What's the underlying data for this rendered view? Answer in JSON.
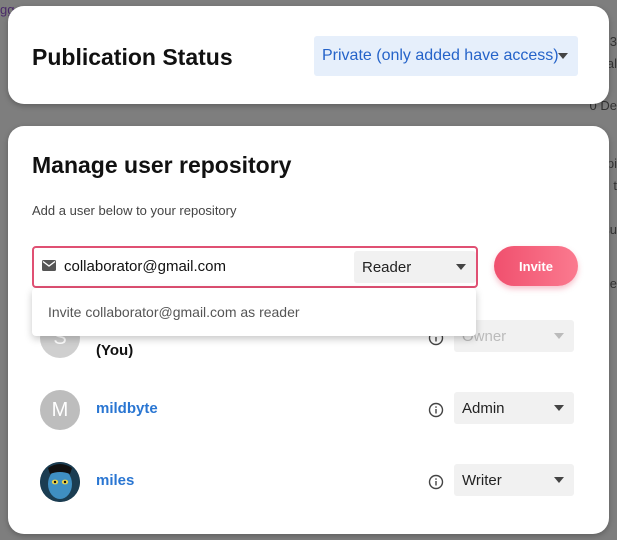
{
  "background": {
    "top_left_text": "gg...",
    "right_fragments": [
      "3",
      "al",
      "0 De",
      "pi",
      "t",
      "su",
      "e"
    ]
  },
  "publication": {
    "title": "Publication Status",
    "status_value": "Private (only added have access)"
  },
  "manage": {
    "title": "Manage user repository",
    "subtitle": "Add a user below to your repository",
    "email_value": "collaborator@gmail.com",
    "role_value": "Reader",
    "invite_label": "Invite",
    "suggestion": "Invite collaborator@gmail.com as reader"
  },
  "users": [
    {
      "initial": "S",
      "name": "(You)",
      "role": "Owner",
      "disabled": true
    },
    {
      "initial": "M",
      "name": "mildbyte",
      "role": "Admin",
      "disabled": false
    },
    {
      "initial": "",
      "name": "miles",
      "role": "Writer",
      "disabled": false
    }
  ],
  "colors": {
    "accent": "#2a76d2",
    "invite_gradient_start": "#f0506e",
    "invite_gradient_end": "#fb7a8f",
    "focus_border": "#e05073"
  }
}
